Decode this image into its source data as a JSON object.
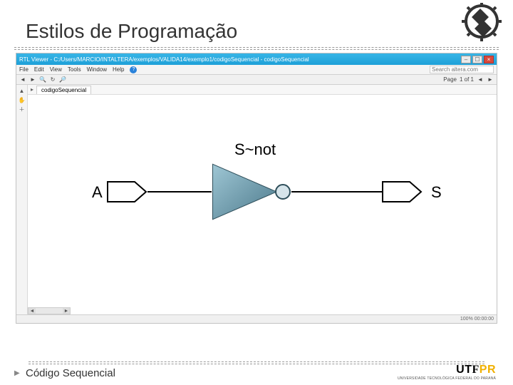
{
  "slide": {
    "title": "Estilos de Programação",
    "caption": "Código Sequencial"
  },
  "app": {
    "titlebar": "RTL Viewer - C:/Users/MARCIO/INTALTERA/exemplos/VALIDA14/exemplo1/codigoSequencial - codigoSequencial",
    "menu": {
      "file": "File",
      "edit": "Edit",
      "view": "View",
      "tools": "Tools",
      "window": "Window",
      "help": "Help"
    },
    "search": {
      "placeholder": "Search altera.com"
    },
    "toolbar": {
      "page_label": "Page",
      "page_value": "1 of 1"
    },
    "tab": "codigoSequencial",
    "status_left": " ",
    "status_right": "100%    00:00:00"
  },
  "diagram": {
    "top_signal": "S~not",
    "input_label": "A",
    "output_label": "S",
    "gate_type": "NOT (inverter with bubble)"
  },
  "branding": {
    "utfpr_main": "UTFPR",
    "utfpr_sub": "UNIVERSIDADE TECNOLÓGICA FEDERAL DO PARANÁ"
  }
}
